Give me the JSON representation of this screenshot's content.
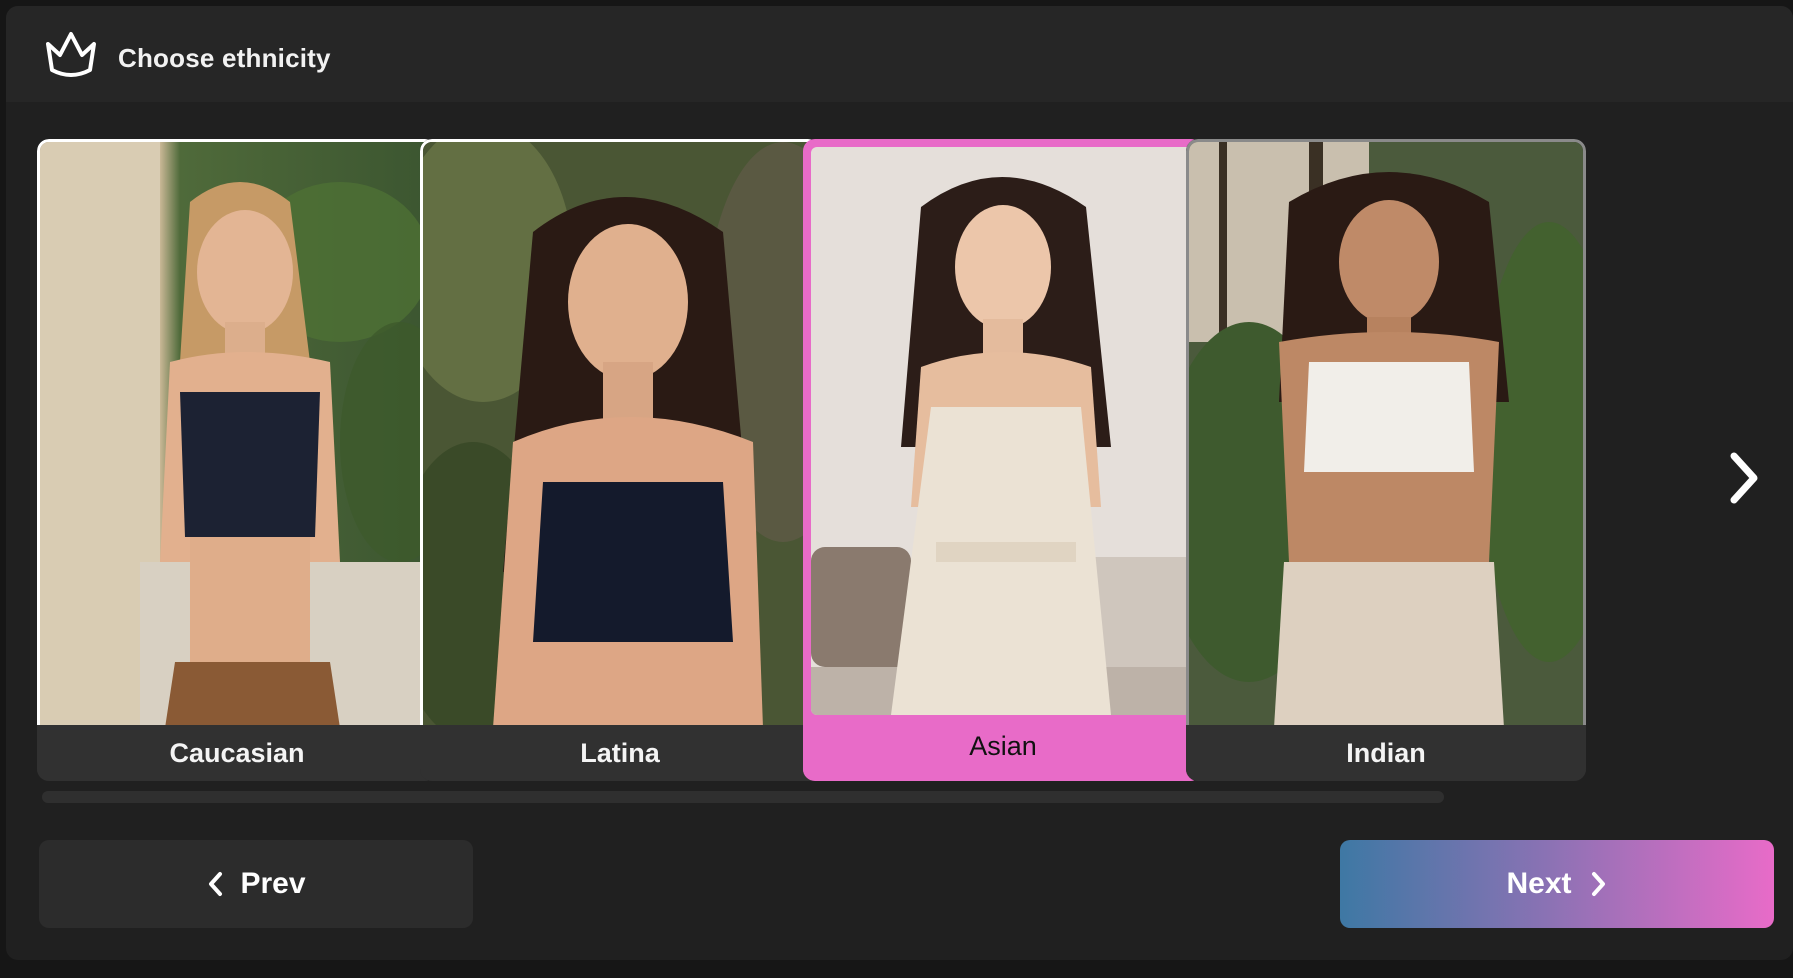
{
  "header": {
    "icon": "crown-icon",
    "title": "Choose ethnicity"
  },
  "cards": [
    {
      "label": "Caucasian",
      "selected": false
    },
    {
      "label": "Latina",
      "selected": false
    },
    {
      "label": "Asian",
      "selected": true
    },
    {
      "label": "Indian",
      "selected": false
    }
  ],
  "carousel": {
    "next_icon": "chevron-right-icon"
  },
  "nav": {
    "prev_label": "Prev",
    "next_label": "Next",
    "prev_icon": "chevron-left-icon",
    "next_icon": "chevron-right-icon"
  },
  "colors": {
    "accent": "#e86bc8",
    "gradient_start": "#3e78a4",
    "gradient_end": "#e86bc8",
    "background": "#202020"
  }
}
